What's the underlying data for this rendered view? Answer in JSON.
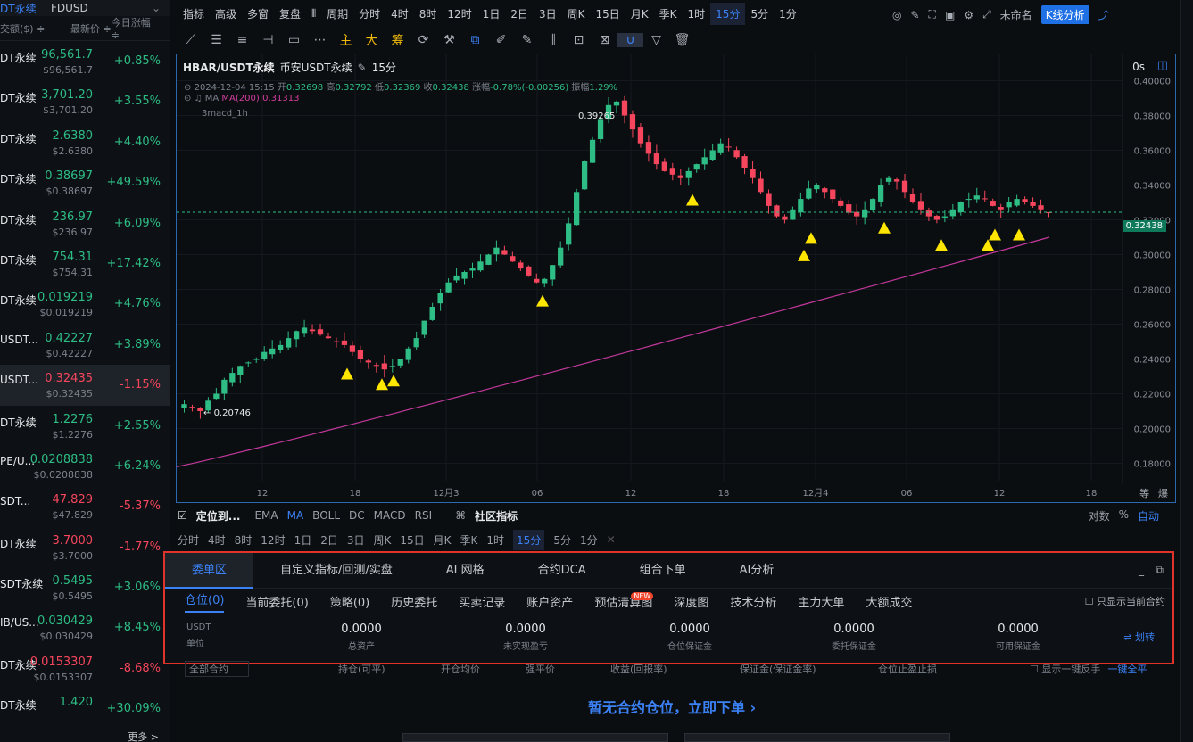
{
  "market": {
    "top_left": "DT永续",
    "top_quote": "FDUSD",
    "col_volume": "交额($) ≑",
    "col_price": "最新价 ≑",
    "col_change": "今日涨幅 ≑",
    "more": "更多 >",
    "rows": [
      {
        "name": "DT永续",
        "price": "96,561.7",
        "usd": "$96,561.7",
        "change": "+0.85%",
        "dir": "up"
      },
      {
        "name": "DT永续",
        "price": "3,701.20",
        "usd": "$3,701.20",
        "change": "+3.55%",
        "dir": "up"
      },
      {
        "name": "DT永续",
        "price": "2.6380",
        "usd": "$2.6380",
        "change": "+4.40%",
        "dir": "up"
      },
      {
        "name": "DT永续",
        "price": "0.38697",
        "usd": "$0.38697",
        "change": "+49.59%",
        "dir": "up"
      },
      {
        "name": "DT永续",
        "price": "236.97",
        "usd": "$236.97",
        "change": "+6.09%",
        "dir": "up"
      },
      {
        "name": "DT永续",
        "price": "754.31",
        "usd": "$754.31",
        "change": "+17.42%",
        "dir": "up"
      },
      {
        "name": "DT永续",
        "price": "0.019219",
        "usd": "$0.019219",
        "change": "+4.76%",
        "dir": "up"
      },
      {
        "name": "USDT...",
        "price": "0.42227",
        "usd": "$0.42227",
        "change": "+3.89%",
        "dir": "up"
      },
      {
        "name": "USDT...",
        "price": "0.32435",
        "usd": "$0.32435",
        "change": "-1.15%",
        "dir": "dn",
        "sel": true
      },
      {
        "name": "DT永续",
        "price": "1.2276",
        "usd": "$1.2276",
        "change": "+2.55%",
        "dir": "up"
      },
      {
        "name": "PE/U...",
        "price": "0.0208838",
        "usd": "$0.0208838",
        "change": "+6.24%",
        "dir": "up"
      },
      {
        "name": "SDT...",
        "price": "47.829",
        "usd": "$47.829",
        "change": "-5.37%",
        "dir": "dn"
      },
      {
        "name": "DT永续",
        "price": "3.7000",
        "usd": "$3.7000",
        "change": "-1.77%",
        "dir": "dn"
      },
      {
        "name": "SDT永续",
        "price": "0.5495",
        "usd": "$0.5495",
        "change": "+3.06%",
        "dir": "up"
      },
      {
        "name": "IB/US...",
        "price": "0.030429",
        "usd": "$0.030429",
        "change": "+8.45%",
        "dir": "up"
      },
      {
        "name": "DT永续",
        "price": "0.0153307",
        "usd": "$0.0153307",
        "change": "-8.68%",
        "dir": "dn"
      },
      {
        "name": "DT永续",
        "price": "1.420",
        "usd": "",
        "change": "+30.09%",
        "dir": "up"
      }
    ]
  },
  "toolbar": {
    "items": [
      "指标",
      "高级",
      "多窗",
      "复盘",
      "",
      "周期",
      "分时",
      "4时",
      "8时",
      "12时",
      "1日",
      "2日",
      "3日",
      "周K",
      "15日",
      "月K",
      "季K",
      "1时",
      "15分",
      "5分",
      "1分"
    ],
    "active": "15分",
    "account": "未命名",
    "kline_btn": "K线分析"
  },
  "drawing_tools": [
    "main-label",
    "big-label",
    "bull-label"
  ],
  "drawing_labels": {
    "main": "主",
    "big": "大",
    "bull": "筹"
  },
  "chart": {
    "symbol": "HBAR/USDT永续",
    "exchange": "币安USDT永续",
    "interval": "15分",
    "countdown": "0s",
    "ohlc_line": {
      "date": "2024-12-04 15:15",
      "open_l": "开",
      "open": "0.32698",
      "high_l": "高",
      "high": "0.32792",
      "low_l": "低",
      "low": "0.32369",
      "close_l": "收",
      "close": "0.32438",
      "chg_l": "涨幅",
      "chg": "-0.78%(-0.00256)",
      "amp_l": "振幅",
      "amp": "1.29%"
    },
    "ma_label": "MA",
    "ma_value": "MA(200):0.31313",
    "indicator": "3macd_1h",
    "current_price": "0.32438",
    "high_mark": "0.39265",
    "low_mark": "0.20746",
    "axis_bottom_right": [
      "等",
      "爆"
    ]
  },
  "chart_data": {
    "type": "candlestick",
    "y_ticks": [
      "0.40000",
      "0.38000",
      "0.36000",
      "0.34000",
      "0.32000",
      "0.30000",
      "0.28000",
      "0.26000",
      "0.24000",
      "0.22000",
      "0.20000",
      "0.18000"
    ],
    "ylim": [
      0.17,
      0.41
    ],
    "x_ticks": [
      "12",
      "18",
      "12月3",
      "06",
      "12",
      "18",
      "12月4",
      "06",
      "12",
      "18"
    ],
    "close": [
      0.214,
      0.212,
      0.21,
      0.216,
      0.22,
      0.228,
      0.232,
      0.236,
      0.238,
      0.24,
      0.244,
      0.246,
      0.248,
      0.252,
      0.256,
      0.258,
      0.256,
      0.254,
      0.252,
      0.25,
      0.248,
      0.244,
      0.24,
      0.238,
      0.236,
      0.234,
      0.236,
      0.24,
      0.246,
      0.252,
      0.262,
      0.27,
      0.278,
      0.284,
      0.288,
      0.29,
      0.292,
      0.296,
      0.3,
      0.304,
      0.3,
      0.296,
      0.292,
      0.288,
      0.284,
      0.286,
      0.294,
      0.304,
      0.318,
      0.336,
      0.354,
      0.366,
      0.378,
      0.386,
      0.388,
      0.38,
      0.372,
      0.364,
      0.358,
      0.352,
      0.348,
      0.346,
      0.344,
      0.348,
      0.352,
      0.356,
      0.36,
      0.364,
      0.362,
      0.356,
      0.35,
      0.344,
      0.336,
      0.328,
      0.322,
      0.32,
      0.326,
      0.332,
      0.338,
      0.34,
      0.336,
      0.332,
      0.328,
      0.324,
      0.322,
      0.326,
      0.332,
      0.34,
      0.344,
      0.342,
      0.336,
      0.33,
      0.326,
      0.322,
      0.32,
      0.322,
      0.326,
      0.33,
      0.332,
      0.334,
      0.332,
      0.328,
      0.326,
      0.33,
      0.332,
      0.33,
      0.328,
      0.326,
      0.324
    ],
    "ma200": [
      0.178,
      0.31
    ],
    "markers": "signal triangles"
  },
  "bottom_indicators": {
    "locate": "定位到...",
    "items": [
      "EMA",
      "MA",
      "BOLL",
      "DC",
      "MACD",
      "RSI"
    ],
    "active": "MA",
    "community": "社区指标",
    "right": [
      "对数",
      "%",
      "自动"
    ]
  },
  "bottom_periods": {
    "items": [
      "分时",
      "4时",
      "8时",
      "12时",
      "1日",
      "2日",
      "3日",
      "周K",
      "15日",
      "月K",
      "季K",
      "1时",
      "15分",
      "5分",
      "1分"
    ],
    "active": "15分"
  },
  "panel": {
    "tabs": [
      "委单区",
      "自定义指标/回测/实盘",
      "AI 网格",
      "合约DCA",
      "组合下单",
      "AI分析"
    ],
    "subtabs": [
      "仓位(0)",
      "当前委托(0)",
      "策略(0)",
      "历史委托",
      "买卖记录",
      "账户资产",
      "预估清算图",
      "深度图",
      "技术分析",
      "主力大单",
      "大额成交"
    ],
    "new_badge": "NEW",
    "only_current": "只显示当前合约",
    "currency": "USDT",
    "unit": "单位",
    "stats": [
      {
        "value": "0.0000",
        "label": "总资产"
      },
      {
        "value": "0.0000",
        "label": "未实现盈亏"
      },
      {
        "value": "0.0000",
        "label": "仓位保证金"
      },
      {
        "value": "0.0000",
        "label": "委托保证金"
      },
      {
        "value": "0.0000",
        "label": "可用保证金"
      }
    ],
    "transfer": "⇌ 划转"
  },
  "below": {
    "all_contracts": "全部合约",
    "cols": [
      "持仓(可平)",
      "开仓均价",
      "强平价",
      "收益(回报率)",
      "保证金(保证金率)",
      "仓位止盈止损"
    ],
    "one_click": "显示一键反手",
    "close_all": "一键全平",
    "empty": "暂无合约仓位，立即下单"
  }
}
